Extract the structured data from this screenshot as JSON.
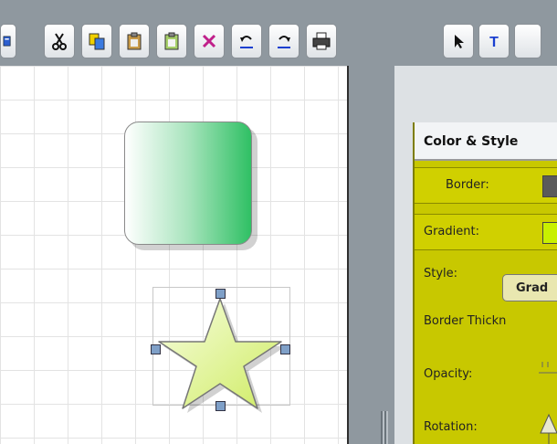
{
  "toolbar": {
    "buttons": [
      {
        "name": "new-doc",
        "icon": "document-icon"
      },
      {
        "name": "cut",
        "icon": "scissors-icon"
      },
      {
        "name": "copy",
        "icon": "copy-icon"
      },
      {
        "name": "paste",
        "icon": "clipboard-icon"
      },
      {
        "name": "paste-special",
        "icon": "clipboard-icon"
      },
      {
        "name": "delete",
        "icon": "x-icon"
      },
      {
        "name": "undo",
        "icon": "undo-icon"
      },
      {
        "name": "redo",
        "icon": "redo-icon"
      },
      {
        "name": "print",
        "icon": "printer-icon"
      },
      {
        "name": "pointer",
        "icon": "cursor-icon"
      },
      {
        "name": "text",
        "icon": "text-icon",
        "label": "T"
      }
    ]
  },
  "canvas": {
    "shapes": [
      {
        "type": "rounded-rectangle",
        "fill_start": "#ffffff",
        "fill_end": "#2fc064"
      },
      {
        "type": "star",
        "fill_start": "#f2fbc8",
        "fill_end": "#d4ef6e",
        "selected": true
      }
    ]
  },
  "panel": {
    "title": "Color & Style",
    "border_label": "Border:",
    "border_color": "#5a5a5a",
    "gradient_label": "Gradient:",
    "gradient_color": "#c8f000",
    "style_label": "Style:",
    "style_value": "Grad",
    "border_thickness_label": "Border Thickn",
    "opacity_label": "Opacity:",
    "rotation_label": "Rotation:"
  },
  "colors": {
    "toolbar_bg": "#8f989f",
    "panel_bg": "#c8c800",
    "accent_blue": "#1a3fd0"
  }
}
